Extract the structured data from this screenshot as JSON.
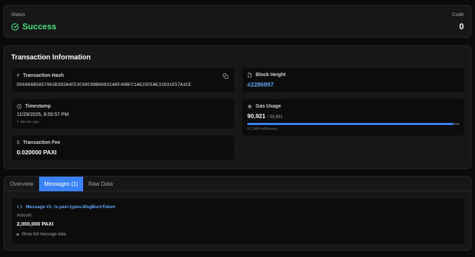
{
  "status": {
    "label": "Status",
    "value": "Success",
    "code_label": "Code",
    "code_value": "0"
  },
  "tx_info": {
    "title": "Transaction Information",
    "hash_label": "Transaction Hash",
    "hash_value": "D56866B5857963D392A4FE3C68C88B0081CA8F40BFC1AE25CEAE32D31E57A1CE",
    "block_label": "Block Height",
    "block_value": "#2286997",
    "timestamp_label": "Timestamp",
    "timestamp_value": "11/29/2025, 8:55:57 PM",
    "timestamp_relative": "1 minute ago",
    "gas_label": "Gas Usage",
    "gas_used": "90,921",
    "gas_limit": "/ 93,691",
    "gas_fraction": 0.9704,
    "gas_efficiency": "97.04% efficiency",
    "fee_label": "Transaction Fee",
    "fee_value": "0.020000 PAXI"
  },
  "tabs": [
    {
      "label": "Overview"
    },
    {
      "label": "Messages (1)"
    },
    {
      "label": "Raw Data"
    }
  ],
  "message": {
    "title": "Message #1: /x.paxi.types.MsgBurnToken",
    "amount_label": "Amount:",
    "amount_value": "2,000,000 PAXI",
    "show_full": "Show full message data"
  },
  "colors": {
    "success": "#4ade80",
    "accent": "#3b82f6",
    "link": "#60a5fa"
  }
}
